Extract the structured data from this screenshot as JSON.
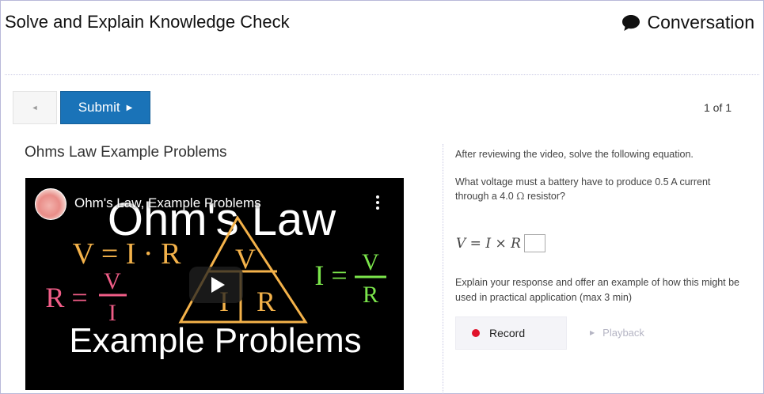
{
  "header": {
    "title": "Solve and Explain Knowledge Check",
    "conversation_label": "Conversation",
    "conversation_icon": "speech-bubble-icon"
  },
  "toolbar": {
    "back_icon": "◄",
    "submit_label": "Submit",
    "submit_icon": "▶",
    "pager": "1 of 1"
  },
  "left": {
    "section_title": "Ohms Law Example Problems",
    "video": {
      "title": "Ohm's Law, Example Problems",
      "art_heading": "Ohm's Law",
      "art_eq1": "V = I · R",
      "art_eq2_lhs": "R =",
      "art_eq2_num": "V",
      "art_eq2_den": "I",
      "art_eq3_lhs": "I =",
      "art_eq3_num": "V",
      "art_eq3_den": "R",
      "art_tri_top": "V",
      "art_tri_left": "I",
      "art_tri_right": "R",
      "art_footer": "Example Problems"
    }
  },
  "right": {
    "instructions": "After reviewing the video, solve the following equation.",
    "question_part1": "What voltage must a battery have to produce 0.5 A current through a 4.0",
    "question_unit": "Ω",
    "question_part2": "resistor?",
    "equation": "V = I × R",
    "answer_value": "",
    "explain": "Explain your response and offer an example of how this might be used in practical application (max 3 min)",
    "record_label": "Record",
    "playback_label": "Playback"
  },
  "colors": {
    "submit_bg": "#1a73b8",
    "record_dot": "#e0122b",
    "art_orange": "#f4b24a",
    "art_green": "#7be54b",
    "art_pink": "#f05d87"
  }
}
